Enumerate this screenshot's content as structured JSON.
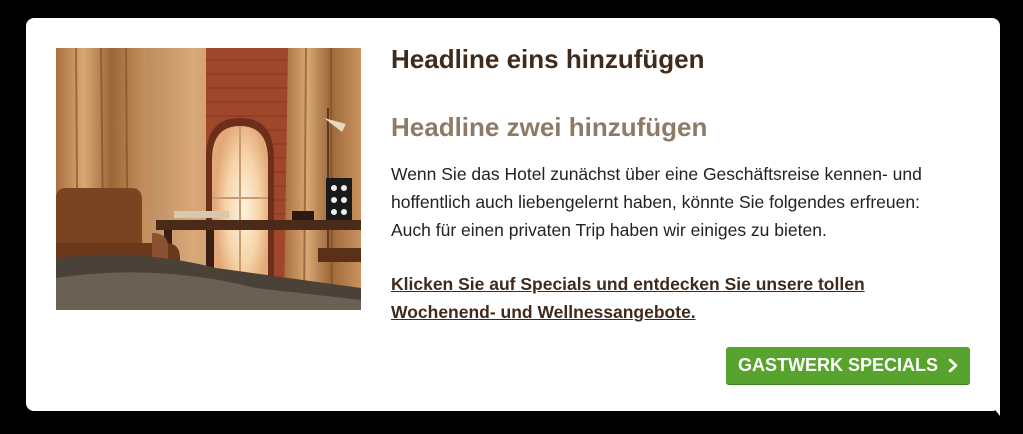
{
  "teaser": {
    "image_alt": "Hotelzimmer mit Rundbogenfenster, Schreibtisch und Sessel",
    "headline1": "Headline eins hinzufügen",
    "headline2": "Headline zwei hinzufügen",
    "body_lines": [
      "Wenn Sie das Hotel zunächst über eine Geschäftsreise kennen- und",
      "hoffentlich auch liebengelernt haben, könnte Sie folgendes erfreuen:",
      "Auch für einen privaten Trip haben wir einiges zu bieten."
    ],
    "link_lines": [
      "Klicken Sie auf Specials und entdecken Sie unsere tollen",
      "Wochenend- und Wellnessangebote."
    ],
    "button_label": "GASTWERK SPECIALS",
    "button_icon": "chevron-right-icon"
  },
  "colors": {
    "headline1": "#3f2a1c",
    "headline2": "#8e7b67",
    "button": "#57a32d",
    "card": "#ffffff",
    "background": "#000000"
  }
}
